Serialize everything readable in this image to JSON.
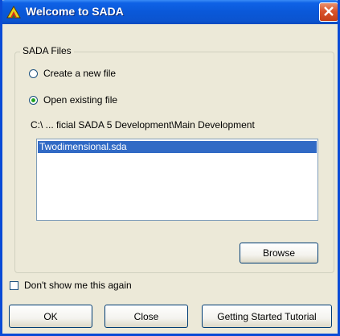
{
  "window": {
    "title": "Welcome to SADA"
  },
  "group": {
    "label": "SADA Files"
  },
  "options": [
    {
      "label": "Create a new file",
      "checked": false
    },
    {
      "label": "Open existing file",
      "checked": true
    }
  ],
  "path": "C:\\ ... ficial SADA 5 Development\\Main Development",
  "files": [
    {
      "name": "Twodimensional.sda",
      "selected": true
    }
  ],
  "buttons": {
    "browse": "Browse",
    "ok": "OK",
    "close": "Close",
    "tutorial": "Getting Started Tutorial"
  },
  "dont_show": {
    "label": "Don't show me this again",
    "checked": false
  },
  "icons": {
    "app": "sada-app-icon",
    "close": "close-icon"
  },
  "colors": {
    "titlebar": "#0a58d8",
    "close_button": "#d9532b",
    "selection": "#316ac5",
    "dialog_bg": "#ece9d8"
  }
}
